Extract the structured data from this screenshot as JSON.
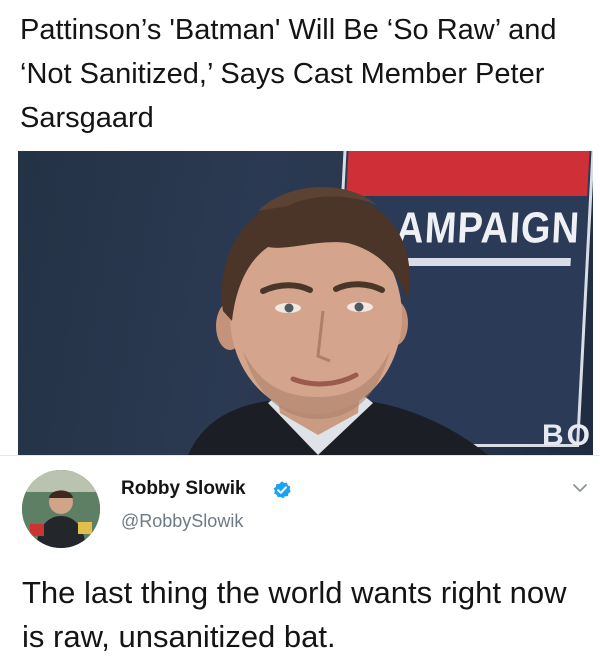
{
  "headline": "Pattinson’s 'Batman' Will Be ‘So Raw’ and ‘Not Sanitized,’ Says Cast Member Peter Sarsgaard",
  "photo": {
    "backdrop_text": "AMPAIGN",
    "backdrop_corner_text": "BO"
  },
  "tweet": {
    "author_name": "Robby Slowik",
    "handle": "@RobbySlowik",
    "text": "The last thing the world wants right now is raw, unsanitized bat."
  },
  "colors": {
    "verified": "#1da1f2",
    "handle": "#6e7a85",
    "text": "#141414"
  }
}
